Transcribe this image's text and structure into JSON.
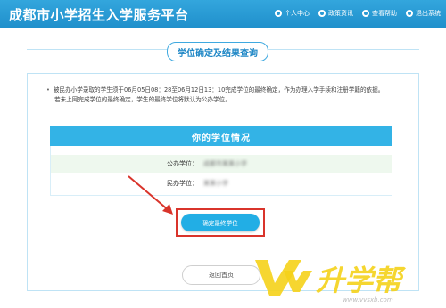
{
  "header": {
    "title": "成都市小学招生入学服务平台",
    "nav": [
      {
        "label": "个人中心",
        "icon": "user-icon"
      },
      {
        "label": "政策资讯",
        "icon": "news-icon"
      },
      {
        "label": "查看帮助",
        "icon": "help-icon"
      },
      {
        "label": "退出系统",
        "icon": "logout-icon"
      }
    ]
  },
  "section_title": "学位确定及结果查询",
  "notice": {
    "line1": "被民办小学录取的学生须于06月05日08：28至06月12日13：10完成学位的最终确定，作为办理入学手续和注册学籍的依据。",
    "line2": "若未上网完成学位的最终确定，学生的最终学位将默认为公办学位。"
  },
  "info": {
    "header": "你的学位情况",
    "public_label": "公办学位：",
    "public_value": "成都市某某小学",
    "private_label": "民办学位：",
    "private_value": "某某小学"
  },
  "buttons": {
    "confirm": "确定最终学位",
    "back": "返回首页"
  },
  "watermark": {
    "logo_text": "升学帮",
    "url": "www.vvsxb.com"
  },
  "colors": {
    "primary": "#1f8fcb",
    "accent": "#22aee5",
    "highlight_red": "#d9342b",
    "watermark_yellow": "#f5d21a"
  }
}
